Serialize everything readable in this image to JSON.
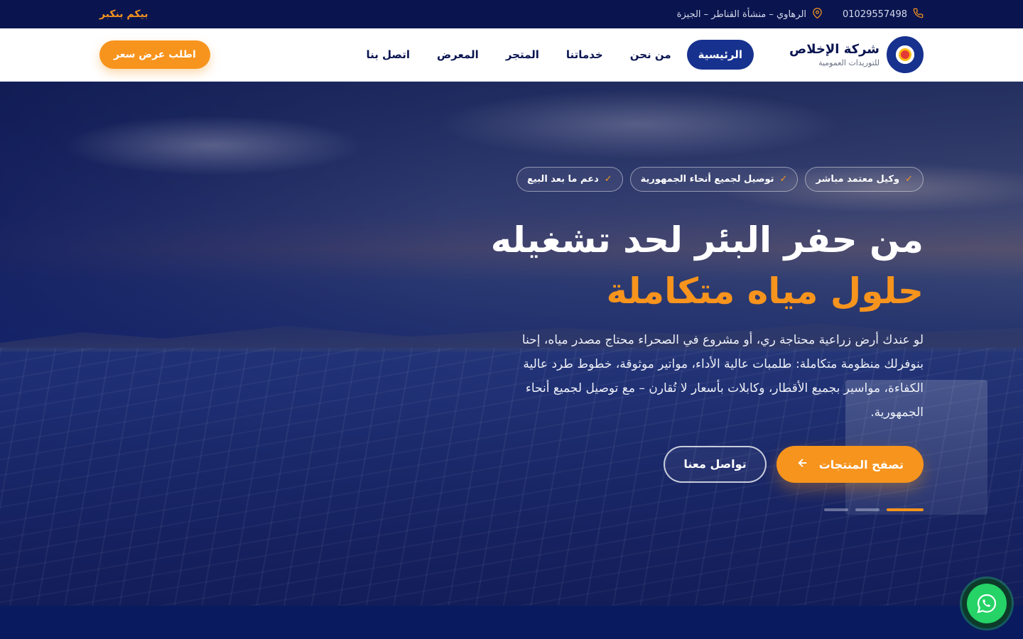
{
  "topbar": {
    "phone": "01029557498",
    "address": "الرهاوي – منشأة القناطر – الجيزة",
    "brand_tagline": "بيكم بنكبر"
  },
  "header": {
    "logo_title": "شركة الإخلاص",
    "logo_subtitle": "للتوريدات العمومية",
    "nav": [
      {
        "label": "الرئيسية",
        "active": true
      },
      {
        "label": "من نحن"
      },
      {
        "label": "خدماتنا"
      },
      {
        "label": "المتجر"
      },
      {
        "label": "المعرض"
      },
      {
        "label": "اتصل بنا"
      }
    ],
    "quote_button": "اطلب عرض سعر"
  },
  "hero": {
    "badges": [
      "وكيل معتمد مباشر",
      "توصيل لجميع أنحاء الجمهورية",
      "دعم ما بعد البيع"
    ],
    "title": "من حفر البئر لحد تشغيله",
    "title_accent": "حلول مياه متكاملة",
    "description": "لو عندك أرض زراعية محتاجة ري، أو مشروع في الصحراء محتاج مصدر مياه، إحنا بنوفرلك منظومة متكاملة: طلمبات عالية الأداء، مواتير موثوقة، خطوط طرد عالية الكفاءة، مواسير بجميع الأقطار، وكابلات بأسعار لا تُقارن – مع توصيل لجميع أنحاء الجمهورية.",
    "primary_button": "تصفح المنتجات",
    "secondary_button": "تواصل معنا",
    "slides_total": 3,
    "slide_active": 1
  },
  "colors": {
    "navy": "#0a1550",
    "primary_blue": "#17318f",
    "accent_orange": "#f7941d",
    "whatsapp_green": "#25d366"
  },
  "icons": {
    "phone": "phone-icon",
    "location": "location-pin-icon",
    "check": "check-icon",
    "arrow": "arrow-left-icon",
    "whatsapp": "whatsapp-icon"
  }
}
